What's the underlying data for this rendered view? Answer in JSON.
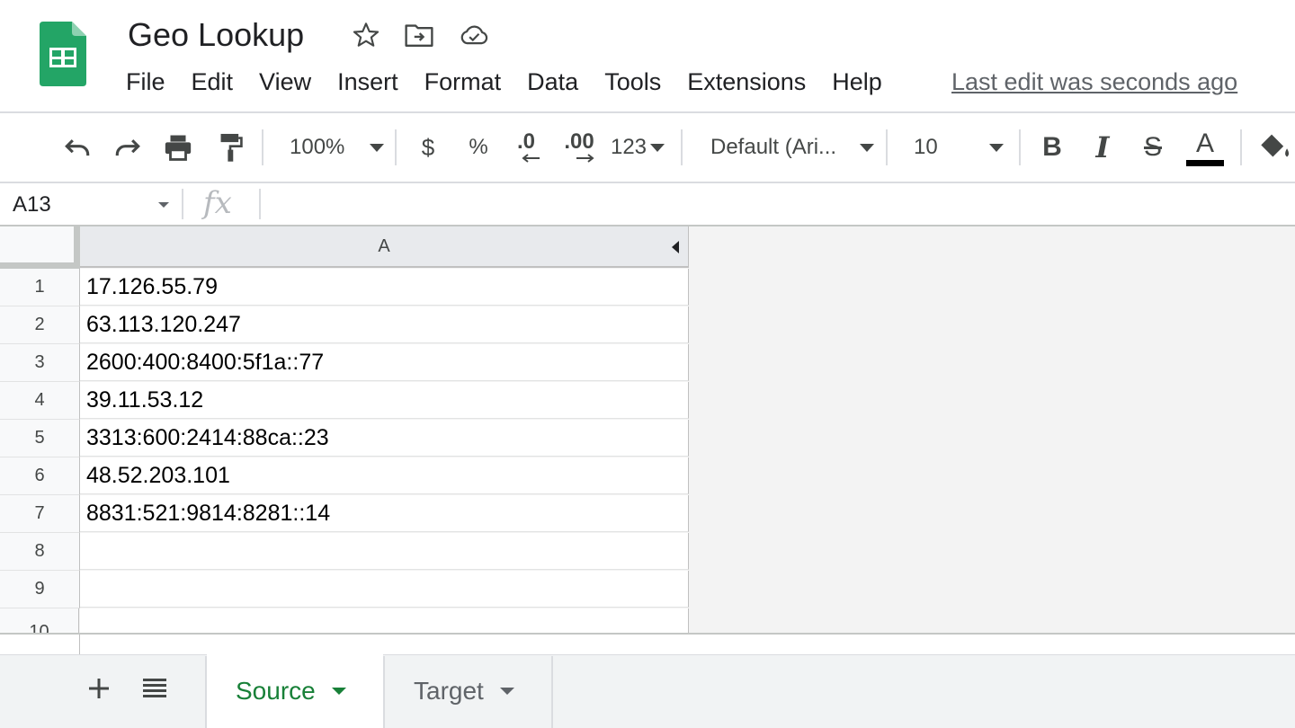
{
  "header": {
    "title": "Geo Lookup",
    "icons": [
      "star-icon",
      "move-to-folder-icon",
      "cloud-saved-icon"
    ],
    "last_edit": "Last edit was seconds ago"
  },
  "menu": [
    "File",
    "Edit",
    "View",
    "Insert",
    "Format",
    "Data",
    "Tools",
    "Extensions",
    "Help"
  ],
  "toolbar": {
    "zoom": "100%",
    "currency": "$",
    "percent": "%",
    "decrease_decimal": ".0",
    "increase_decimal": ".00",
    "more_formats": "123",
    "font": "Default (Ari...",
    "font_size": "10",
    "bold": "B",
    "italic": "I",
    "strikethrough": "S",
    "text_color": "A",
    "text_color_value": "#000000"
  },
  "formula_bar": {
    "name_box": "A13",
    "fx": "fx",
    "formula": ""
  },
  "grid": {
    "columns": [
      "A"
    ],
    "row_numbers": [
      "1",
      "2",
      "3",
      "4",
      "5",
      "6",
      "7",
      "8",
      "9",
      "10"
    ],
    "cells": [
      "17.126.55.79",
      "63.113.120.247",
      "2600:400:8400:5f1a::77",
      "39.11.53.12",
      "3313:600:2414:88ca::23",
      "48.52.203.101",
      "8831:521:9814:8281::14",
      "",
      "",
      ""
    ]
  },
  "sheets": {
    "tabs": [
      {
        "label": "Source",
        "active": true
      },
      {
        "label": "Target",
        "active": false
      }
    ]
  },
  "colors": {
    "brand_green": "#188038",
    "logo_green": "#23a566"
  }
}
